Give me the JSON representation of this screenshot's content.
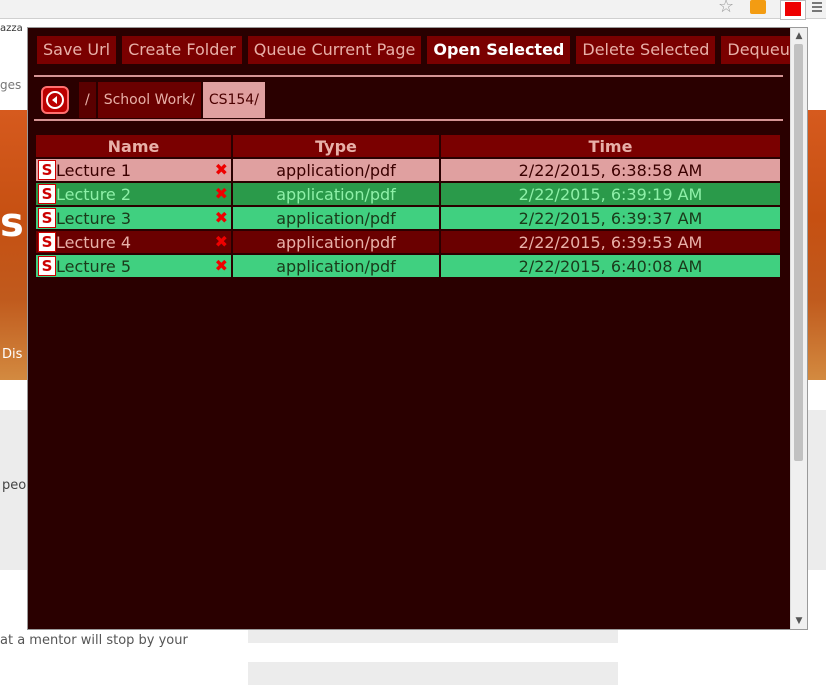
{
  "background": {
    "tab_fragment": "azza",
    "side_fragment": "ges",
    "hero_fragment": "s",
    "hero_link_fragment": "Dis",
    "text_fragment_1": "peo",
    "text_fragment_2": "at a mentor will stop by your"
  },
  "browser": {
    "star_icon": "star-icon",
    "rss_icon": "rss-icon",
    "extension_icon": "extension-icon"
  },
  "toolbar": {
    "buttons": [
      {
        "label": "Save Url",
        "active": false
      },
      {
        "label": "Create Folder",
        "active": false
      },
      {
        "label": "Queue Current Page",
        "active": false
      },
      {
        "label": "Open Selected",
        "active": true
      },
      {
        "label": "Delete Selected",
        "active": false
      },
      {
        "label": "Dequeue",
        "active": false
      }
    ]
  },
  "breadcrumb": {
    "back_icon": "back-arrow-icon",
    "items": [
      "/",
      "School Work/",
      "CS154/"
    ]
  },
  "table": {
    "columns": [
      "Name",
      "Type",
      "Time"
    ],
    "rows": [
      {
        "icon": "S",
        "name": "Lecture 1",
        "type": "application/pdf",
        "time": "2/22/2015, 6:38:58 AM",
        "style": "pink"
      },
      {
        "icon": "S",
        "name": "Lecture 2",
        "type": "application/pdf",
        "time": "2/22/2015, 6:39:19 AM",
        "style": "dark-green"
      },
      {
        "icon": "S",
        "name": "Lecture 3",
        "type": "application/pdf",
        "time": "2/22/2015, 6:39:37 AM",
        "style": "green"
      },
      {
        "icon": "S",
        "name": "Lecture 4",
        "type": "application/pdf",
        "time": "2/22/2015, 6:39:53 AM",
        "style": "maroon"
      },
      {
        "icon": "S",
        "name": "Lecture 5",
        "type": "application/pdf",
        "time": "2/22/2015, 6:40:08 AM",
        "style": "green"
      }
    ],
    "delete_glyph": "✖"
  },
  "colors": {
    "popup_bg": "#2a0000",
    "button_bg": "#7a0000",
    "row_pink": "#e0a0a0",
    "row_dark_green": "#2a9a4a",
    "row_green": "#40d080",
    "row_maroon": "#6a0000"
  }
}
